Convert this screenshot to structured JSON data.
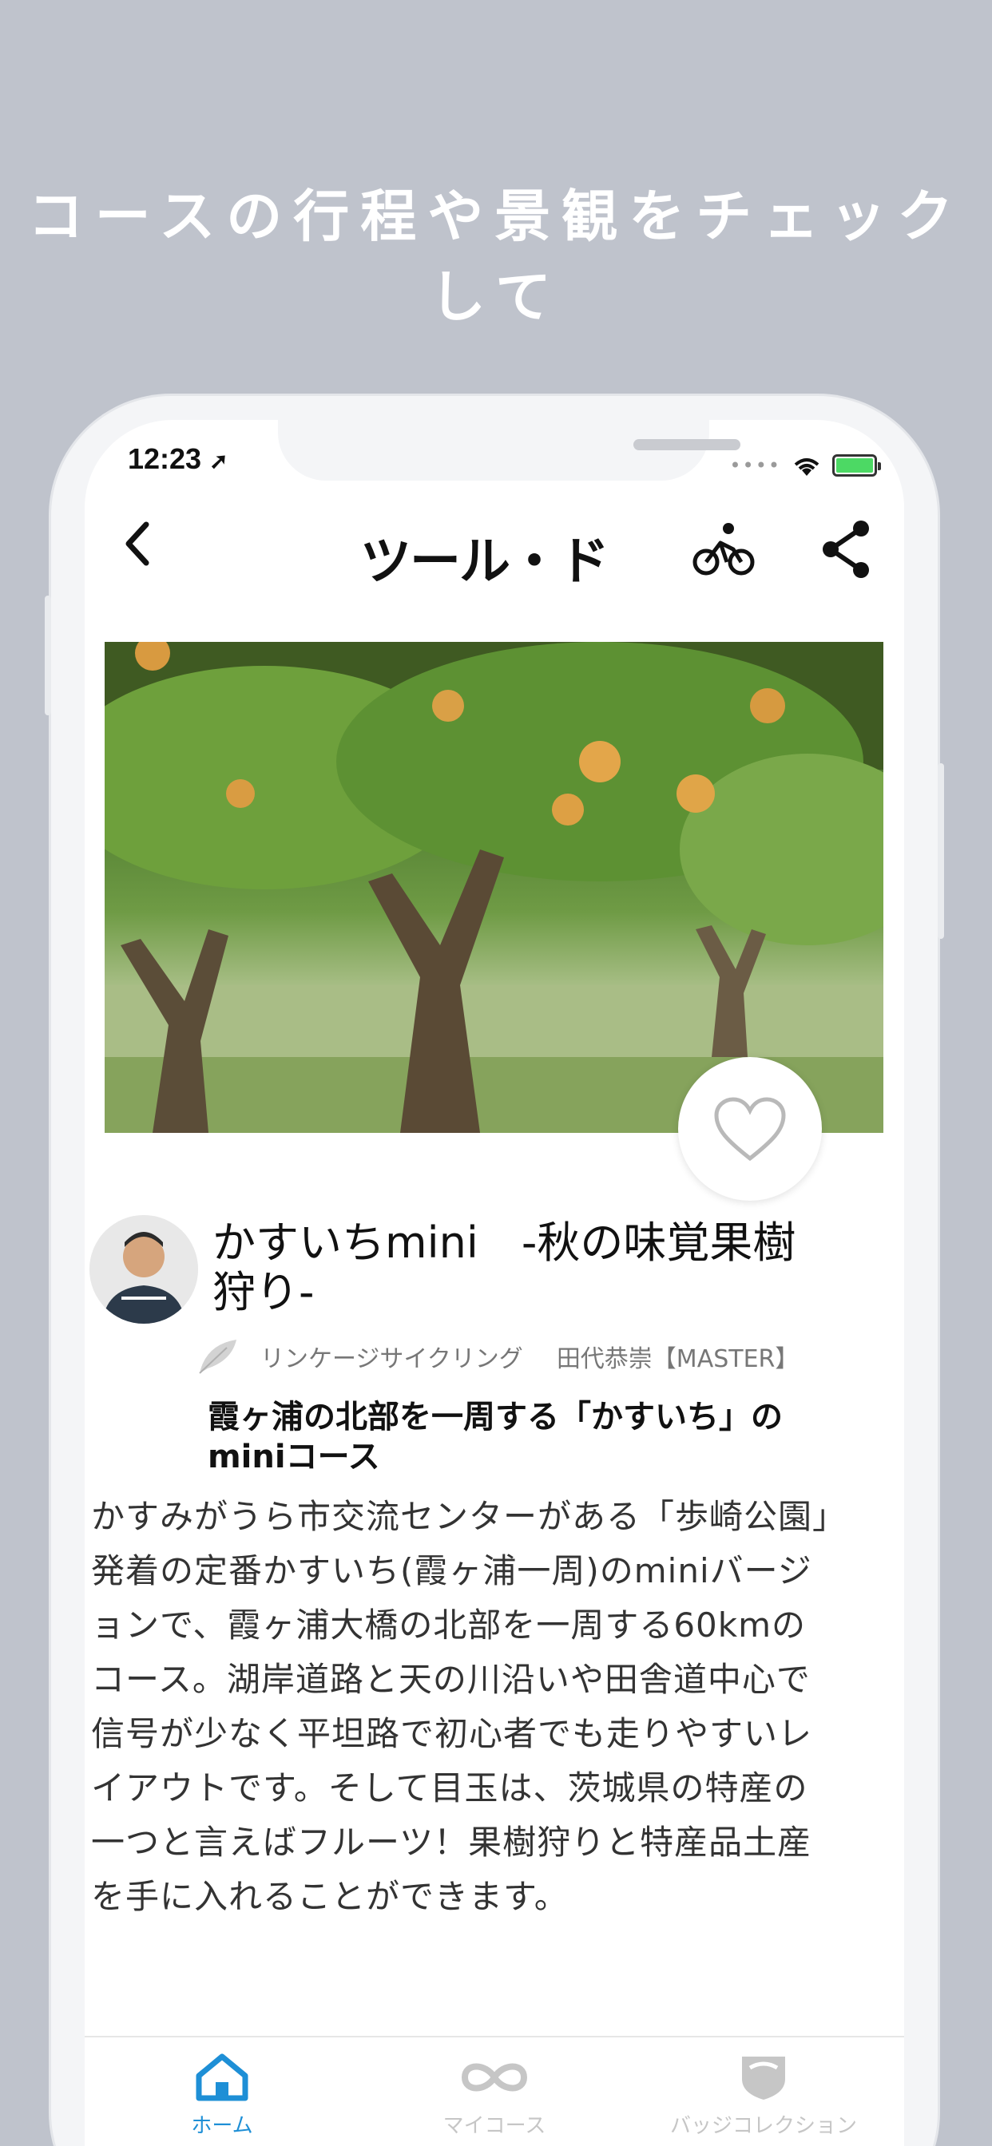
{
  "headline": "コースの行程や景観をチェックして",
  "status_bar": {
    "time": "12:23"
  },
  "navbar": {
    "logo": "ツール・ド"
  },
  "course": {
    "title": "かすいちmini　-秋の味覚果樹狩り-",
    "organizer": "リンケージサイクリング",
    "author": "田代恭崇【MASTER】",
    "subtitle": "霞ヶ浦の北部を一周する「かすいち」のminiコース",
    "description": "かすみがうら市交流センターがある「歩崎公園」発着の定番かすいち(霞ヶ浦一周)のminiバージョンで、霞ヶ浦大橋の北部を一周する60kmのコース。湖岸道路と天の川沿いや田舎道中心で信号が少なく平坦路で初心者でも走りやすいレイアウトです。そして目玉は、茨城県の特産の一つと言えばフルーツ！果樹狩りと特産品土産を手に入れることができます。"
  },
  "tabs": [
    {
      "label": "ホーム",
      "icon": "home-icon",
      "active": true
    },
    {
      "label": "マイコース",
      "icon": "infinity-icon",
      "active": false
    },
    {
      "label": "バッジコレクション",
      "icon": "badge-icon",
      "active": false
    }
  ],
  "colors": {
    "background": "#bfc3cc",
    "accent": "#1e8fd6",
    "inactive_tab": "#c6c6c6"
  }
}
